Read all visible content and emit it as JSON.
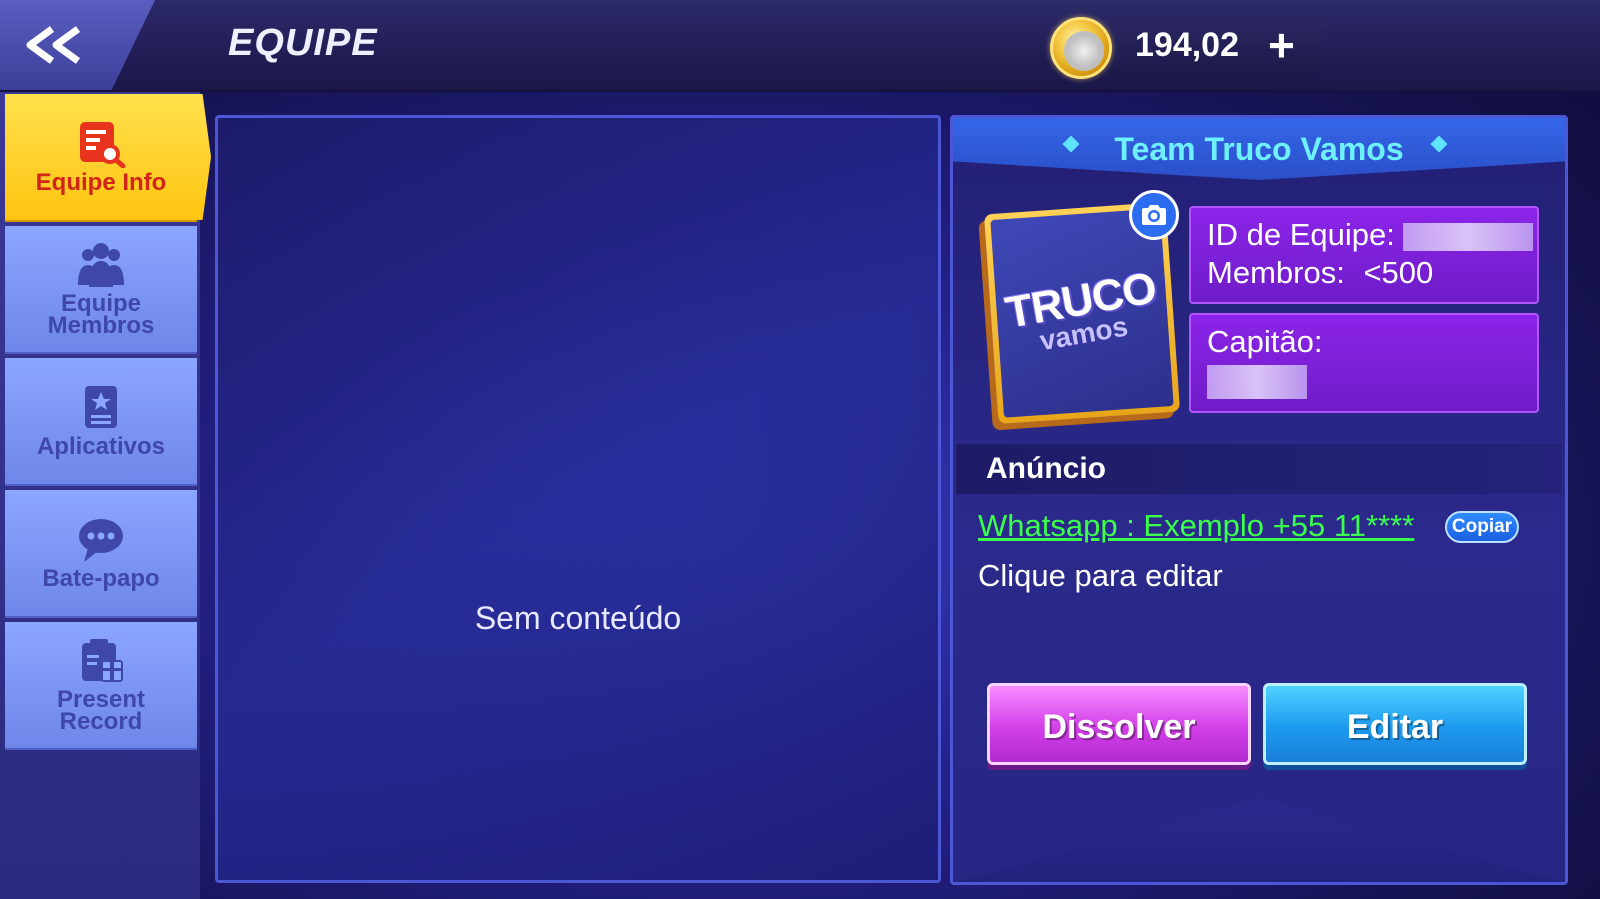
{
  "header": {
    "title": "EQUIPE",
    "coins": "194,02",
    "plus_label": "+",
    "icons": {
      "back": "double-chevron-left-icon",
      "coin": "coin-icon",
      "plus": "plus-icon"
    }
  },
  "sidebar": {
    "items": [
      {
        "label": "Equipe Info",
        "icon": "team-info-icon",
        "active": true
      },
      {
        "label": "Equipe Membros",
        "icon": "team-members-icon",
        "active": false
      },
      {
        "label": "Aplicativos",
        "icon": "applications-icon",
        "active": false
      },
      {
        "label": "Bate-papo",
        "icon": "chat-icon",
        "active": false
      },
      {
        "label": "Present Record",
        "icon": "gift-record-icon",
        "active": false
      }
    ]
  },
  "main": {
    "empty_text": "Sem conteúdo"
  },
  "team": {
    "name": "Team Truco Vamos",
    "logo_line1": "TRUCO",
    "logo_line2": "vamos",
    "id_label": "ID de Equipe:",
    "members_label": "Membros:",
    "members_value": "<500",
    "captain_label": "Capitão:",
    "announcement_header": "Anúncio",
    "whatsapp_text": "Whatsapp : Exemplo +55 11****",
    "copy_label": "Copiar",
    "edit_hint": "Clique para editar",
    "dissolve_label": "Dissolver",
    "edit_label": "Editar"
  },
  "colors": {
    "accent_yellow": "#ffc411",
    "link_green": "#39ff4b",
    "team_name_cyan": "#6ff0ff",
    "info_purple": "#8c24e8"
  }
}
